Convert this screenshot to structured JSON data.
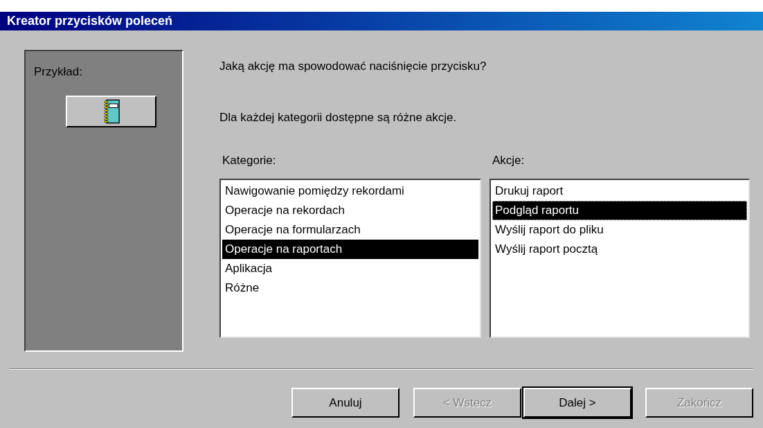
{
  "window": {
    "title": "Kreator przycisków poleceń"
  },
  "sample": {
    "label": "Przykład:"
  },
  "question": "Jaką akcję ma spowodować naciśnięcie przycisku?",
  "hint": "Dla każdej kategorii dostępne są różne akcje.",
  "categories": {
    "label": "Kategorie:",
    "items": [
      {
        "text": "Nawigowanie pomiędzy rekordami",
        "selected": false
      },
      {
        "text": "Operacje na rekordach",
        "selected": false
      },
      {
        "text": "Operacje na formularzach",
        "selected": false
      },
      {
        "text": "Operacje na raportach",
        "selected": true
      },
      {
        "text": "Aplikacja",
        "selected": false
      },
      {
        "text": "Różne",
        "selected": false
      }
    ]
  },
  "actions": {
    "label": "Akcje:",
    "items": [
      {
        "text": "Drukuj raport",
        "selected": false
      },
      {
        "text": "Podgląd raportu",
        "selected": true
      },
      {
        "text": "Wyślij raport do pliku",
        "selected": false
      },
      {
        "text": "Wyślij raport pocztą",
        "selected": false
      }
    ]
  },
  "buttons": [
    {
      "label": "Anuluj",
      "disabled": false,
      "default": false
    },
    {
      "label": "< Wstecz",
      "disabled": true,
      "default": false
    },
    {
      "label": "Dalej >",
      "disabled": false,
      "default": true
    },
    {
      "label": "Zakończ",
      "disabled": true,
      "default": false
    }
  ]
}
